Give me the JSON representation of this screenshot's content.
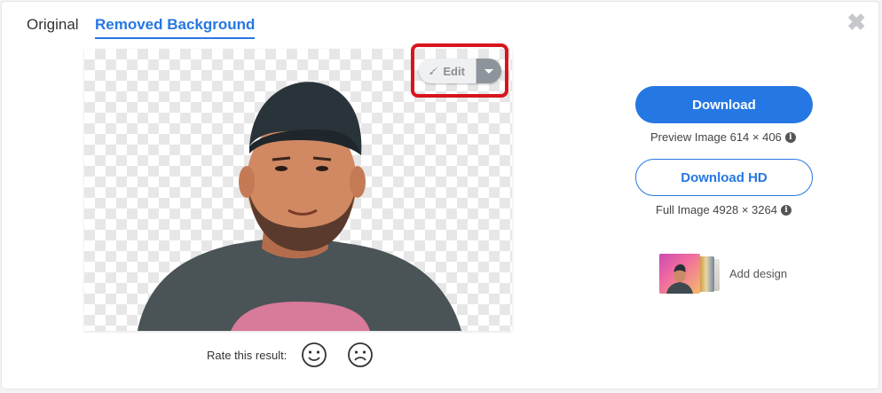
{
  "tabs": {
    "original": "Original",
    "removed": "Removed Background"
  },
  "close_icon": "close-icon",
  "edit": {
    "label": "Edit",
    "icon": "brush-icon",
    "dropdown_icon": "caret-down-icon"
  },
  "rate": {
    "label": "Rate this result:",
    "positive_icon": "smile-icon",
    "negative_icon": "frown-icon"
  },
  "download": {
    "label": "Download",
    "preview_info": "Preview Image 614 × 406",
    "hd_label": "Download HD",
    "full_info": "Full Image 4928 × 3264"
  },
  "add_design": {
    "label": "Add design"
  },
  "colors": {
    "accent": "#2577e3",
    "highlight": "#d7151d"
  }
}
